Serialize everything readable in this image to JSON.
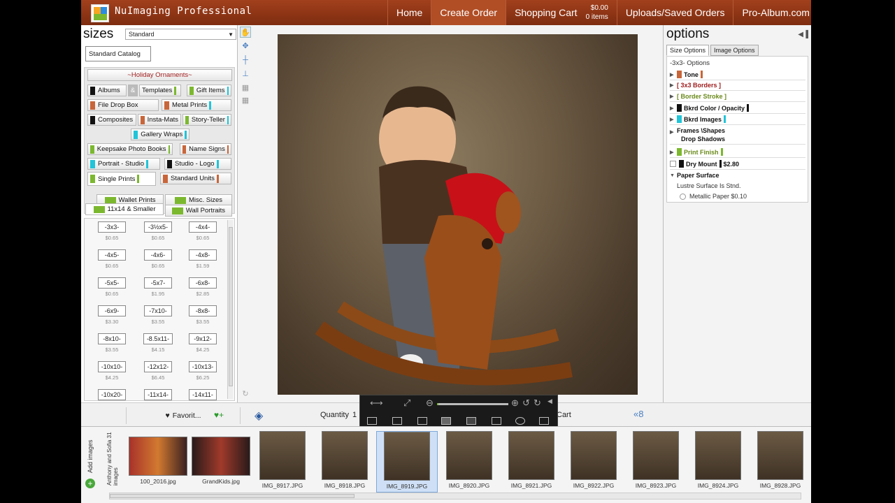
{
  "header": {
    "brand": "NuImaging Professional",
    "nav": [
      "Home",
      "Create Order",
      "Shopping Cart",
      "Uploads/Saved Orders",
      "Pro-Album.com"
    ],
    "cart_total": "$0.00",
    "cart_items": "0 items"
  },
  "left": {
    "title": "sizes",
    "select_value": "Standard",
    "catalog_tab": "Standard Catalog",
    "holiday": "~Holiday Ornaments~",
    "categories": {
      "albums": "Albums",
      "amp": "&",
      "templates": "Templates",
      "gift_items": "Gift Items",
      "file_drop": "File Drop Box",
      "metal_prints": "Metal Prints",
      "composites": "Composites",
      "insta_mats": "Insta-Mats",
      "story_teller": "Story-Teller",
      "gallery_wraps": "Gallery Wraps",
      "keepsake": "Keepsake Photo Books",
      "name_signs": "Name Signs",
      "portrait_studio": "Portrait - Studio",
      "studio_logo": "Studio - Logo",
      "single_prints": "Single Prints",
      "standard_units": "Standard Units",
      "wallet_prints": "Wallet Prints",
      "misc_sizes": "Misc. Sizes",
      "smaller": "11x14 & Smaller",
      "wall_portraits": "Wall Portraits"
    },
    "sizes": [
      {
        "label": "-3x3-",
        "price": "$0.65"
      },
      {
        "label": "-3½x5-",
        "price": "$0.65"
      },
      {
        "label": "-4x4-",
        "price": "$0.65"
      },
      {
        "label": "-4x5-",
        "price": "$0.65"
      },
      {
        "label": "-4x6-",
        "price": "$0.65"
      },
      {
        "label": "-4x8-",
        "price": "$1.59"
      },
      {
        "label": "-5x5-",
        "price": "$0.65"
      },
      {
        "label": "-5x7-",
        "price": "$1.95"
      },
      {
        "label": "-6x8-",
        "price": "$2.85"
      },
      {
        "label": "-6x9-",
        "price": "$3.30"
      },
      {
        "label": "-7x10-",
        "price": "$3.55"
      },
      {
        "label": "-8x8-",
        "price": "$3.55"
      },
      {
        "label": "-8x10-",
        "price": "$3.55"
      },
      {
        "label": "-8.5x11-",
        "price": "$4.15"
      },
      {
        "label": "-9x12-",
        "price": "$4.25"
      },
      {
        "label": "-10x10-",
        "price": "$4.25"
      },
      {
        "label": "-12x12-",
        "price": "$6.45"
      },
      {
        "label": "-10x13-",
        "price": "$6.25"
      },
      {
        "label": "-10x20-",
        "price": ""
      },
      {
        "label": "-11x14-",
        "price": ""
      },
      {
        "label": "-14x11-",
        "price": ""
      }
    ]
  },
  "right": {
    "title": "options",
    "tabs": [
      "Size Options",
      "Image Options"
    ],
    "heading": "-3x3-  Options",
    "rows": {
      "tone": "Tone",
      "borders": "[ 3x3 Borders ]",
      "border_stroke": "[ Border Stroke ]",
      "bkrd_color": "Bkrd Color / Opacity",
      "bkrd_images": "Bkrd Images",
      "frames": "Frames \\Shapes",
      "drop_shadows": "Drop Shadows",
      "print_finish": "Print Finish",
      "dry_mount": "Dry Mount",
      "dry_mount_price": "$2.80",
      "paper_surface": "Paper Surface",
      "lustre": "Lustre Surface Is Stnd.",
      "metallic": "Metallic Paper $0.10"
    }
  },
  "bottom": {
    "favorites": "Favorit...",
    "quantity_label": "Quantity",
    "quantity_value": "1",
    "cart": "Cart"
  },
  "filmstrip": {
    "add_images": "Add images",
    "folder": "Anthony and Sofia",
    "count": "31 images",
    "images": [
      "100_2016.jpg",
      "GrandKids.jpg",
      "IMG_8917.JPG",
      "IMG_8918.JPG",
      "IMG_8919.JPG",
      "IMG_8920.JPG",
      "IMG_8921.JPG",
      "IMG_8922.JPG",
      "IMG_8923.JPG",
      "IMG_8924.JPG",
      "IMG_8928.JPG"
    ]
  },
  "zoom": {
    "value_fraction": 0.02
  },
  "colors": {
    "header": "#8c3514",
    "black": "#111111",
    "green": "#7cb82f",
    "cyan": "#21c4d8",
    "orange": "#c8663a"
  }
}
